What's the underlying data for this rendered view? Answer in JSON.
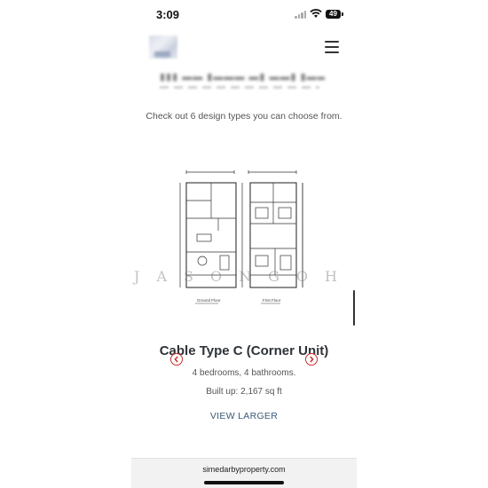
{
  "status_bar": {
    "time": "3:09",
    "battery": "49"
  },
  "header": {
    "logo_icon": "property-logo-icon",
    "menu_icon": "hamburger-menu-icon"
  },
  "intro": {
    "text": "Check out 6 design types you can choose from."
  },
  "floorplan": {
    "ground_label": "Ground Floor",
    "first_label": "First Floor"
  },
  "watermark": {
    "text": "JASONGOH"
  },
  "design": {
    "title": "Cable Type C (Corner Unit)",
    "rooms": "4 bedrooms, 4 bathrooms.",
    "built_up": "Built up: 2,167 sq ft",
    "view_larger": "VIEW LARGER"
  },
  "browser": {
    "url": "simedarbyproperty.com"
  },
  "colors": {
    "accent_red": "#c9302c",
    "link_blue": "#3a5a78",
    "title_dark": "#2e3338"
  }
}
